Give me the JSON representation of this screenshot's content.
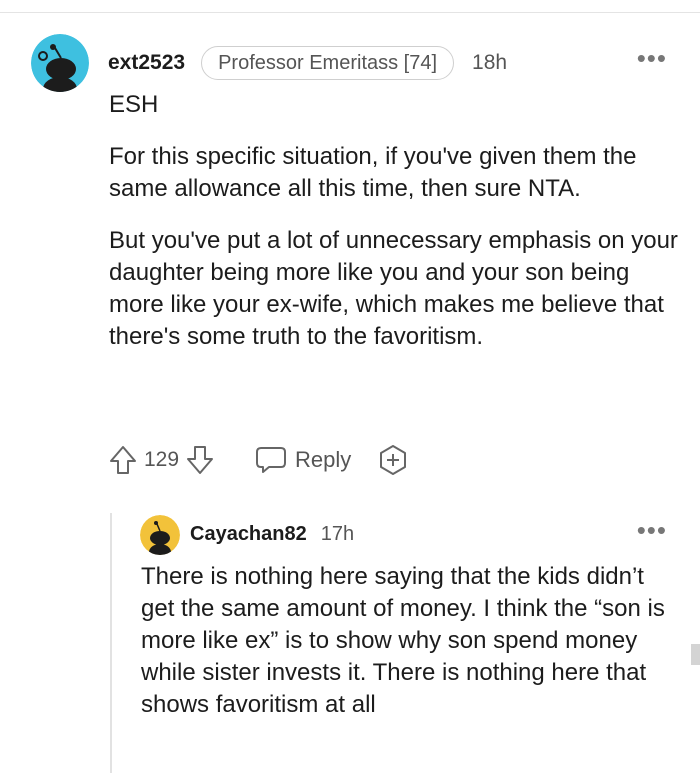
{
  "comment": {
    "username": "ext2523",
    "flair": "Professor Emeritass [74]",
    "time": "18h",
    "paragraphs": [
      "ESH",
      "For this specific situation, if you've given them the same allowance all this time, then sure NTA.",
      "But you've put a lot of unnecessary emphasis on your daughter being more like you and your son being more like your ex-wife, which makes me believe that there's some truth to the favoritism."
    ],
    "score": "129",
    "reply_label": "Reply",
    "avatar_color": "#3ec0e0"
  },
  "reply": {
    "username": "Cayachan82",
    "time": "17h",
    "text": "There is nothing here saying that the kids didn’t get the same amount of money. I think the “son is more like ex” is to show why son spend money while sister invests it. There is nothing here that shows favoritism at all",
    "avatar_color": "#f2c23a"
  },
  "icons": {
    "more": "more-options-icon",
    "upvote": "upvote-arrow-icon",
    "downvote": "downvote-arrow-icon",
    "reply": "speech-bubble-icon",
    "award": "award-plus-icon"
  }
}
